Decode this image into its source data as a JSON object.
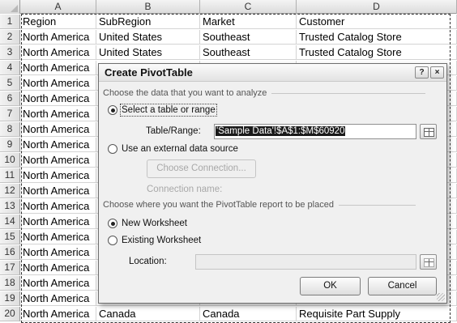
{
  "sheet": {
    "columns": [
      "A",
      "B",
      "C",
      "D"
    ],
    "rows": [
      {
        "num": "1",
        "a": "Region",
        "b": "SubRegion",
        "c": "Market",
        "d": "Customer"
      },
      {
        "num": "2",
        "a": "North America",
        "b": "United States",
        "c": "Southeast",
        "d": "Trusted Catalog Store"
      },
      {
        "num": "3",
        "a": "North America",
        "b": "United States",
        "c": "Southeast",
        "d": "Trusted Catalog Store"
      },
      {
        "num": "4",
        "a": "North America",
        "b": "",
        "c": "",
        "d": ""
      },
      {
        "num": "5",
        "a": "North America",
        "b": "",
        "c": "",
        "d": ""
      },
      {
        "num": "6",
        "a": "North America",
        "b": "",
        "c": "",
        "d": ""
      },
      {
        "num": "7",
        "a": "North America",
        "b": "",
        "c": "",
        "d": ""
      },
      {
        "num": "8",
        "a": "North America",
        "b": "",
        "c": "",
        "d": ""
      },
      {
        "num": "9",
        "a": "North America",
        "b": "",
        "c": "",
        "d": ""
      },
      {
        "num": "10",
        "a": "North America",
        "b": "",
        "c": "",
        "d": ""
      },
      {
        "num": "11",
        "a": "North America",
        "b": "",
        "c": "",
        "d": ""
      },
      {
        "num": "12",
        "a": "North America",
        "b": "",
        "c": "",
        "d": ""
      },
      {
        "num": "13",
        "a": "North America",
        "b": "",
        "c": "",
        "d": ""
      },
      {
        "num": "14",
        "a": "North America",
        "b": "",
        "c": "",
        "d": ""
      },
      {
        "num": "15",
        "a": "North America",
        "b": "",
        "c": "",
        "d": ""
      },
      {
        "num": "16",
        "a": "North America",
        "b": "",
        "c": "",
        "d": ""
      },
      {
        "num": "17",
        "a": "North America",
        "b": "",
        "c": "",
        "d": ""
      },
      {
        "num": "18",
        "a": "North America",
        "b": "",
        "c": "",
        "d": ""
      },
      {
        "num": "19",
        "a": "North America",
        "b": "",
        "c": "",
        "d": ""
      },
      {
        "num": "20",
        "a": "North America",
        "b": "Canada",
        "c": "Canada",
        "d": "Requisite Part Supply"
      }
    ]
  },
  "dialog": {
    "title": "Create PivotTable",
    "help_icon": "question-mark-icon",
    "close_icon": "close-x-icon",
    "section_data": "Choose the data that you want to analyze",
    "radio_table": "Select a table or range",
    "table_range_label": "Table/Range:",
    "table_range_value": "'Sample Data'!$A$1:$M$60920",
    "radio_external": "Use an external data source",
    "choose_connection": "Choose Connection...",
    "connection_name_label": "Connection name:",
    "section_place": "Choose where you want the PivotTable report to be placed",
    "radio_new": "New Worksheet",
    "radio_existing": "Existing Worksheet",
    "location_label": "Location:",
    "location_value": "",
    "ok": "OK",
    "cancel": "Cancel",
    "selected_data_source": "table",
    "selected_placement": "new"
  }
}
